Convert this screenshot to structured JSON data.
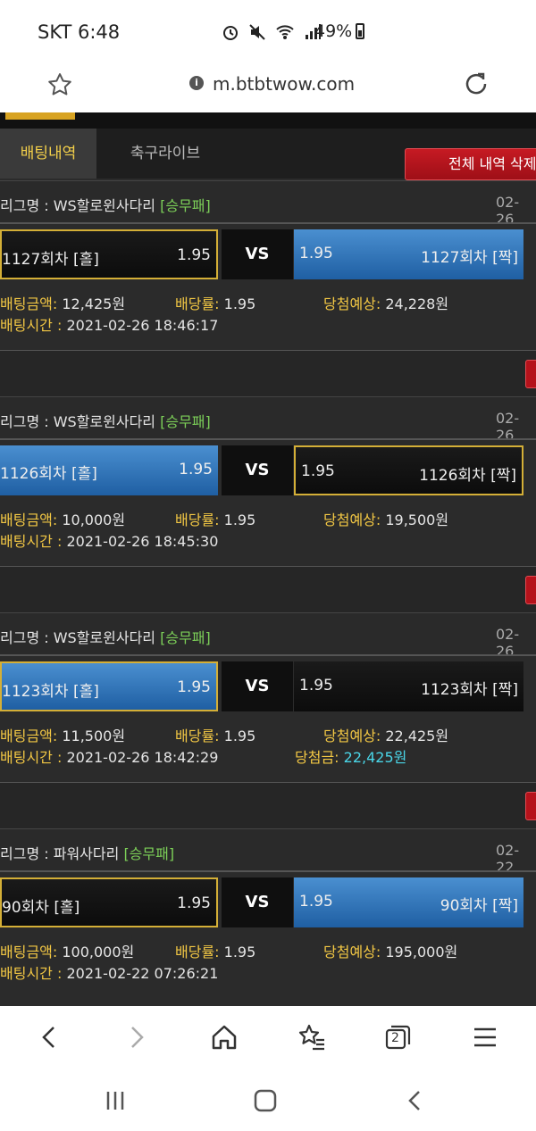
{
  "status": {
    "carrier": "SKT 6:48",
    "battery": "49%"
  },
  "browser": {
    "url": "m.btbtwow.com"
  },
  "tabs": {
    "active": "배팅내역",
    "inactive": "축구라이브",
    "delete_all": "전체 내역 삭제"
  },
  "labels": {
    "league_prefix": "리그명 : ",
    "bet_amount": "배팅금액: ",
    "odds": "배당률: ",
    "expected": "당첨예상: ",
    "bet_time": "배팅시간 : ",
    "won": "당첨금: ",
    "vs": "VS"
  },
  "bets": [
    {
      "league": "WS할로윈사다리",
      "tag": "[승무패]",
      "date": "02-26",
      "left": "1127회차 [홀]",
      "left_odds": "1.95",
      "right": "1127회차 [짝]",
      "right_odds": "1.95",
      "amount": "12,425원",
      "odds": "1.95",
      "expected": "24,228원",
      "time": "2021-02-26 18:46:17"
    },
    {
      "league": "WS할로윈사다리",
      "tag": "[승무패]",
      "date": "02-26",
      "left": "1126회차 [홀]",
      "left_odds": "1.95",
      "right": "1126회차 [짝]",
      "right_odds": "1.95",
      "amount": "10,000원",
      "odds": "1.95",
      "expected": "19,500원",
      "time": "2021-02-26 18:45:30"
    },
    {
      "league": "WS할로윈사다리",
      "tag": "[승무패]",
      "date": "02-26",
      "left": "1123회차 [홀]",
      "left_odds": "1.95",
      "right": "1123회차 [짝]",
      "right_odds": "1.95",
      "amount": "11,500원",
      "odds": "1.95",
      "expected": "22,425원",
      "time": "2021-02-26 18:42:29",
      "won": "22,425원"
    },
    {
      "league": "파워사다리",
      "tag": "[승무패]",
      "date": "02-22",
      "left": "90회차 [홀]",
      "left_odds": "1.95",
      "right": "90회차 [짝]",
      "right_odds": "1.95",
      "amount": "100,000원",
      "odds": "1.95",
      "expected": "195,000원",
      "time": "2021-02-22 07:26:21"
    }
  ],
  "nav": {
    "tab_count": "2"
  },
  "colors": {
    "accent_gold": "#f2c744",
    "pick_blue": "#2f74bf",
    "delete_red": "#b5121b",
    "won_cyan": "#4ad6e8"
  }
}
